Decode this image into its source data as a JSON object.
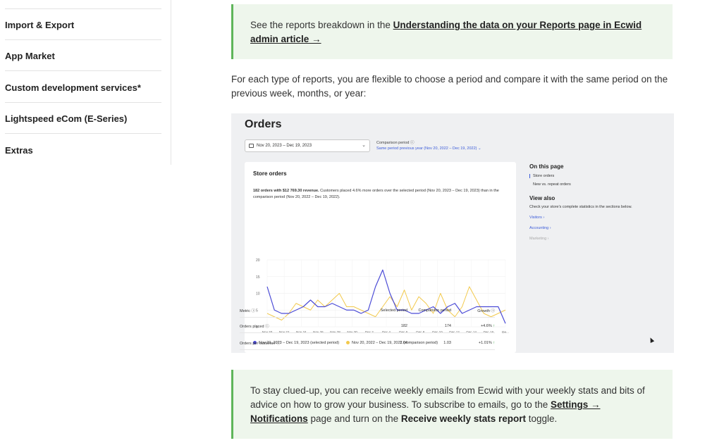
{
  "sidebar": {
    "items": [
      {
        "label": "Import & Export"
      },
      {
        "label": "App Market"
      },
      {
        "label": "Custom development services*"
      },
      {
        "label": "Lightspeed eCom (E-Series)"
      },
      {
        "label": "Extras"
      }
    ]
  },
  "callout_top": {
    "text_before": "See the reports breakdown in the ",
    "link": "Understanding the data on your Reports page in Ecwid admin article →"
  },
  "intro": {
    "text": "For each type of reports, you are flexible to choose a period and compare it with the same period on the previous week, months, or year:"
  },
  "screenshot": {
    "title": "Orders",
    "date_range": "Nov 20, 2023 – Dec 19, 2023",
    "comparison_label": "Comparison period ⓘ",
    "comparison_value": "Same period previous year (Nov 20, 2022 – Dec 19, 2022) ⌄",
    "card": {
      "title": "Store orders",
      "desc_bold": "182 orders with $12 769.30 revenue.",
      "desc_rest": " Customers placed 4.6% more orders over the selected period (Nov 20, 2023 – Dec 19, 2023) than in the comparison period (Nov 20, 2022 – Dec 19, 2022).",
      "legend_selected": "Nov 20, 2023 – Dec 19, 2023 (selected period)",
      "legend_comparison": "Nov 20, 2022 – Dec 19, 2022 (comparison period)",
      "table": {
        "headers": [
          "Metric ⓘ",
          "Selected period",
          "Comparison period",
          "Growth ⓘ"
        ],
        "rows": [
          [
            "Orders placed ⓘ",
            "182",
            "174",
            "+4.6% ↑"
          ],
          [
            "Orders per customer ⓘ",
            "1.04",
            "1.03",
            "+1.01% ↑"
          ]
        ]
      }
    },
    "aside": {
      "on_this_page": "On this page",
      "toc": [
        "Store orders",
        "New vs. repeat orders"
      ],
      "view_also": "View also",
      "view_also_desc": "Check your store's complete statistics in the sections below.",
      "links": [
        "Visitors ›",
        "Accounting ›"
      ],
      "muted_link": "Marketing ›"
    },
    "colors": {
      "selected": "#4b4bd6",
      "comparison": "#f2c94c"
    },
    "chart_data": {
      "type": "line",
      "x": [
        "Nov 20",
        "Nov 22",
        "Nov 24",
        "Nov 26",
        "Nov 28",
        "Nov 30",
        "Dec 2",
        "Dec 4",
        "Dec 6",
        "Dec 8",
        "Dec 10",
        "Dec 12",
        "Dec 14",
        "Dec 16",
        "De..."
      ],
      "ylim": [
        0,
        20
      ],
      "yticks": [
        0,
        5,
        10,
        15,
        20
      ],
      "series": [
        {
          "name": "Nov 20, 2023 – Dec 19, 2023 (selected period)",
          "values": [
            12,
            5,
            4,
            4,
            5,
            6,
            8,
            6,
            6,
            7,
            6,
            5,
            5,
            4,
            5,
            12,
            17,
            10,
            5,
            5,
            4,
            4,
            5,
            6,
            4,
            6,
            7,
            4,
            5,
            6,
            6,
            6,
            6,
            1
          ]
        },
        {
          "name": "Nov 20, 2022 – Dec 19, 2022 (comparison period)",
          "values": [
            4,
            3,
            2,
            4,
            7,
            6,
            5,
            8,
            6,
            8,
            10,
            6,
            6,
            5,
            4,
            3,
            6,
            9,
            6,
            11,
            5,
            9,
            7,
            4,
            10,
            5,
            3,
            6,
            12,
            8,
            4,
            3,
            4,
            5
          ]
        }
      ]
    }
  },
  "callout_bottom": {
    "text1": "To stay clued-up, you can receive weekly emails from Ecwid with your weekly stats and bits of advice on how to grow your business. To subscribe to emails, go to the ",
    "link": "Settings → Notifications",
    "text2": " page and turn on the ",
    "bold": "Receive weekly stats report",
    "text3": " toggle."
  }
}
